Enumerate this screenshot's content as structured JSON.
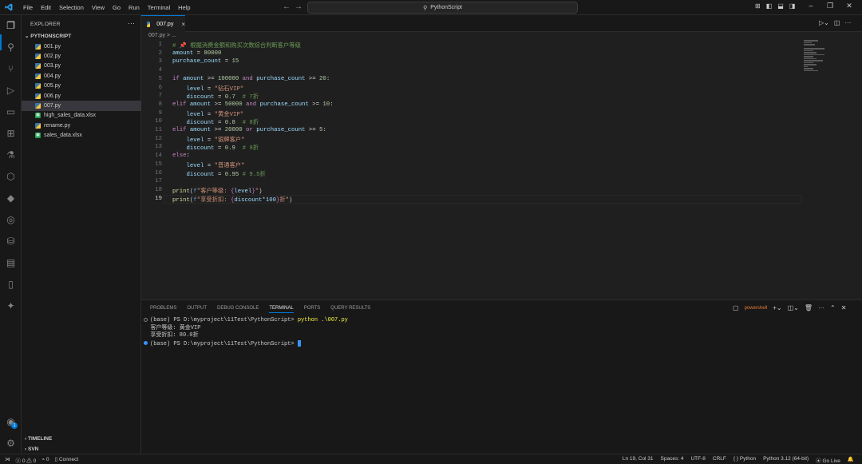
{
  "menu": [
    "File",
    "Edit",
    "Selection",
    "View",
    "Go",
    "Run",
    "Terminal",
    "Help"
  ],
  "search": {
    "text": "PythonScript"
  },
  "explorer": {
    "title": "EXPLORER",
    "folder": "PYTHONSCRIPT",
    "files": [
      {
        "name": "001.py",
        "type": "py"
      },
      {
        "name": "002.py",
        "type": "py"
      },
      {
        "name": "003.py",
        "type": "py"
      },
      {
        "name": "004.py",
        "type": "py"
      },
      {
        "name": "005.py",
        "type": "py"
      },
      {
        "name": "006.py",
        "type": "py"
      },
      {
        "name": "007.py",
        "type": "py",
        "selected": true
      },
      {
        "name": "high_sales_data.xlsx",
        "type": "xlsx"
      },
      {
        "name": "rename.py",
        "type": "py"
      },
      {
        "name": "sales_data.xlsx",
        "type": "xlsx"
      }
    ],
    "timeline": "TIMELINE",
    "svn": "SVN"
  },
  "tab": {
    "label": "007.py"
  },
  "breadcrumb": "007.py > ...",
  "code_lines": [
    "# 📌 根据消费金额和购买次数综合判断客户等级",
    "amount = 80000",
    "purchase_count = 15",
    "",
    "if amount >= 100000 and purchase_count >= 20:",
    "    level = \"钻石VIP\"",
    "    discount = 0.7  # 7折",
    "elif amount >= 50000 and purchase_count >= 10:",
    "    level = \"黄金VIP\"",
    "    discount = 0.8  # 8折",
    "elif amount >= 20000 or purchase_count >= 5:",
    "    level = \"银牌客户\"",
    "    discount = 0.9  # 9折",
    "else:",
    "    level = \"普通客户\"",
    "    discount = 0.95 # 9.5折",
    "",
    "print(f\"客户等级: {level}\")",
    "print(f\"享受折扣: {discount*100}折\")"
  ],
  "current_line": 19,
  "panel": {
    "tabs": [
      "PROBLEMS",
      "OUTPUT",
      "DEBUG CONSOLE",
      "TERMINAL",
      "PORTS",
      "QUERY RESULTS"
    ],
    "active": "TERMINAL",
    "shell": "powershell"
  },
  "terminal": {
    "prompt1": "(base) PS D:\\myproject\\11Test\\PythonScript> ",
    "cmd": "python .\\007.py",
    "out1": "客户等级: 黄金VIP",
    "out2": "享受折扣: 80.0折",
    "prompt2": "(base) PS D:\\myproject\\11Test\\PythonScript> "
  },
  "status": {
    "errors": "0",
    "warnings": "0",
    "ports": "0",
    "connect": "Connect",
    "position": "Ln 19, Col 31",
    "spaces": "Spaces: 4",
    "encoding": "UTF-8",
    "eol": "CRLF",
    "lang": "Python",
    "interpreter": "Python 3.12 (64-bit)",
    "golive": "Go Live"
  },
  "account_badge": "1"
}
